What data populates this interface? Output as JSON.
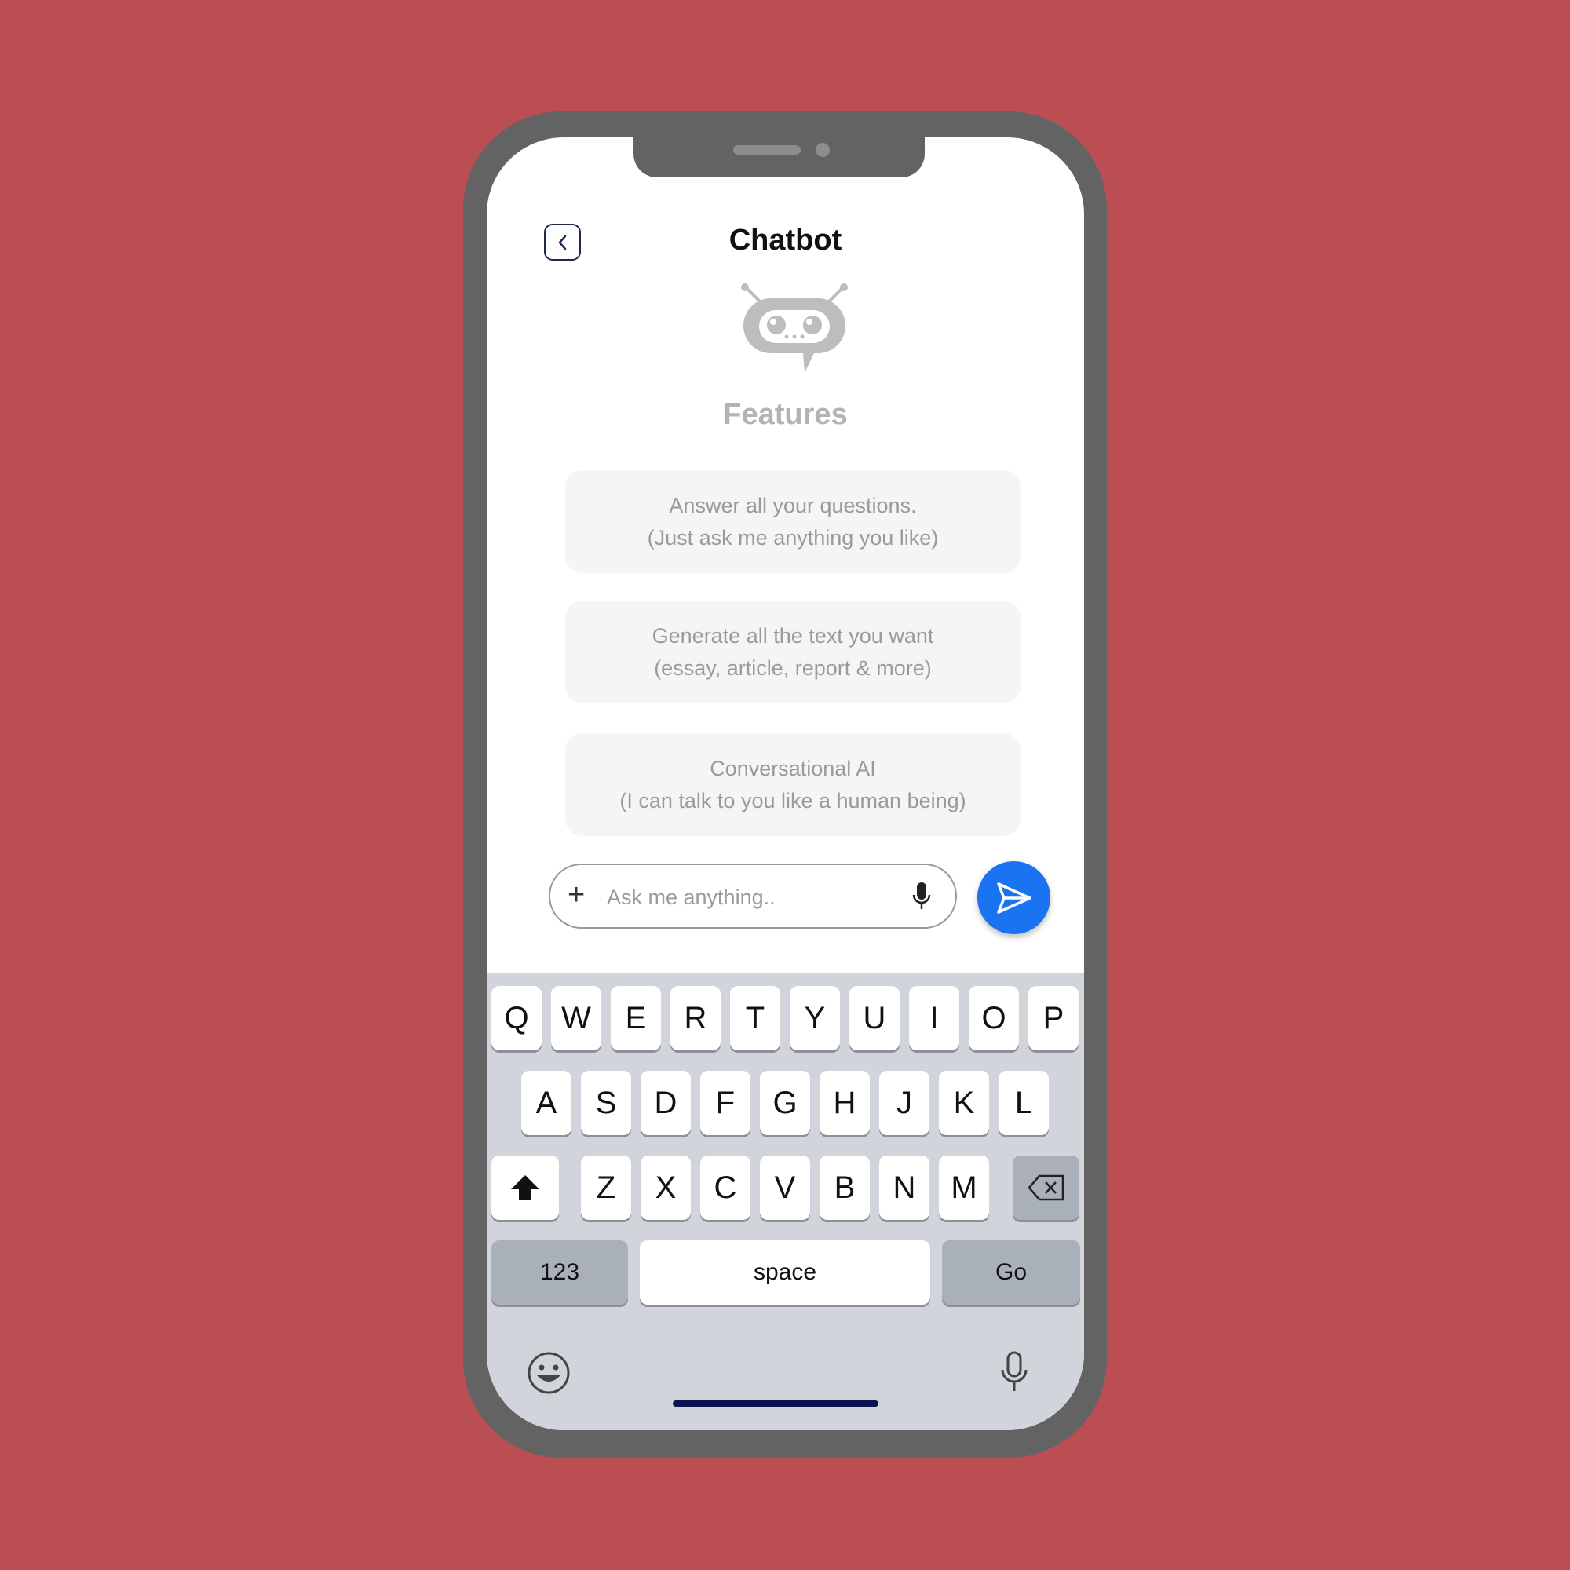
{
  "header": {
    "title": "Chatbot"
  },
  "features": {
    "title": "Features",
    "items": [
      {
        "line1": "Answer all your questions.",
        "line2": "(Just ask me anything you like)"
      },
      {
        "line1": "Generate all the text you want",
        "line2": "(essay, article, report & more)"
      },
      {
        "line1": "Conversational AI",
        "line2": "(I can talk to you like a human being)"
      }
    ]
  },
  "chat_input": {
    "placeholder": "Ask me anything.."
  },
  "keyboard": {
    "row1": [
      "Q",
      "W",
      "E",
      "R",
      "T",
      "Y",
      "U",
      "I",
      "O",
      "P"
    ],
    "row2": [
      "A",
      "S",
      "D",
      "F",
      "G",
      "H",
      "J",
      "K",
      "L"
    ],
    "row3": [
      "Z",
      "X",
      "C",
      "V",
      "B",
      "N",
      "M"
    ],
    "numbers_label": "123",
    "space_label": "space",
    "go_label": "Go"
  },
  "colors": {
    "background": "#bb4e53",
    "phone_frame": "#636363",
    "accent": "#1a73f0",
    "keyboard_bg": "#d1d4db"
  },
  "icons": [
    "back-icon",
    "robot-icon",
    "plus-icon",
    "mic-icon",
    "send-icon",
    "shift-icon",
    "backspace-icon",
    "emoji-icon",
    "dictation-icon"
  ]
}
